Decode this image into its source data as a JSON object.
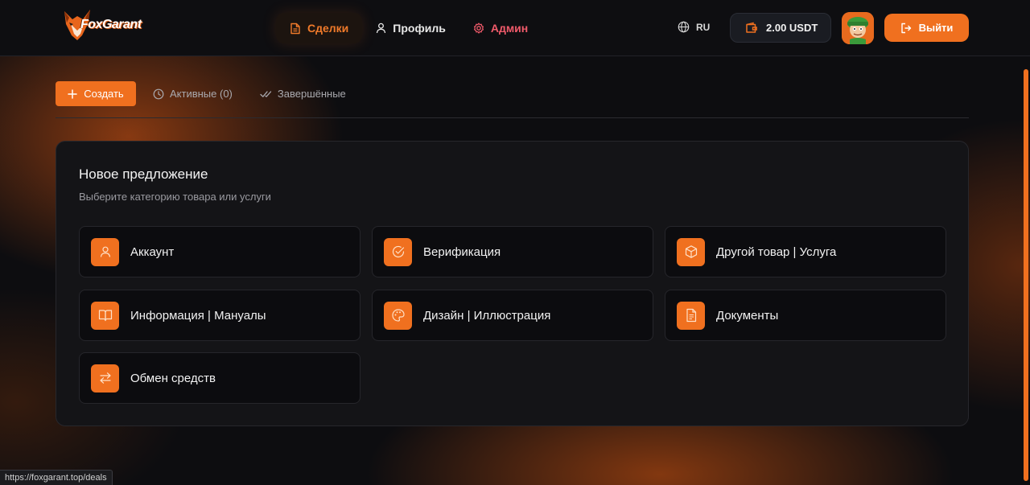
{
  "header": {
    "logo_text": "FoxGarant",
    "nav": {
      "deals": "Сделки",
      "profile": "Профиль",
      "admin": "Админ"
    },
    "lang": "RU",
    "balance": "2.00 USDT",
    "logout": "Выйти"
  },
  "tabs": {
    "create": "Создать",
    "active": "Активные (0)",
    "completed": "Завершённые"
  },
  "panel": {
    "title": "Новое предложение",
    "subtitle": "Выберите категорию товара или услуги",
    "categories": [
      {
        "label": "Аккаунт",
        "icon": "user-icon"
      },
      {
        "label": "Верификация",
        "icon": "check-circle-icon"
      },
      {
        "label": "Другой товар | Услуга",
        "icon": "box-icon"
      },
      {
        "label": "Информация | Мануалы",
        "icon": "book-icon"
      },
      {
        "label": "Дизайн | Иллюстрация",
        "icon": "palette-icon"
      },
      {
        "label": "Документы",
        "icon": "document-icon"
      },
      {
        "label": "Обмен средств",
        "icon": "exchange-icon"
      }
    ]
  },
  "status_url": "https://foxgarant.top/deals",
  "colors": {
    "accent": "#f0701f",
    "admin": "#ef5a6a",
    "panel": "#141417",
    "card": "#0c0c0f"
  }
}
